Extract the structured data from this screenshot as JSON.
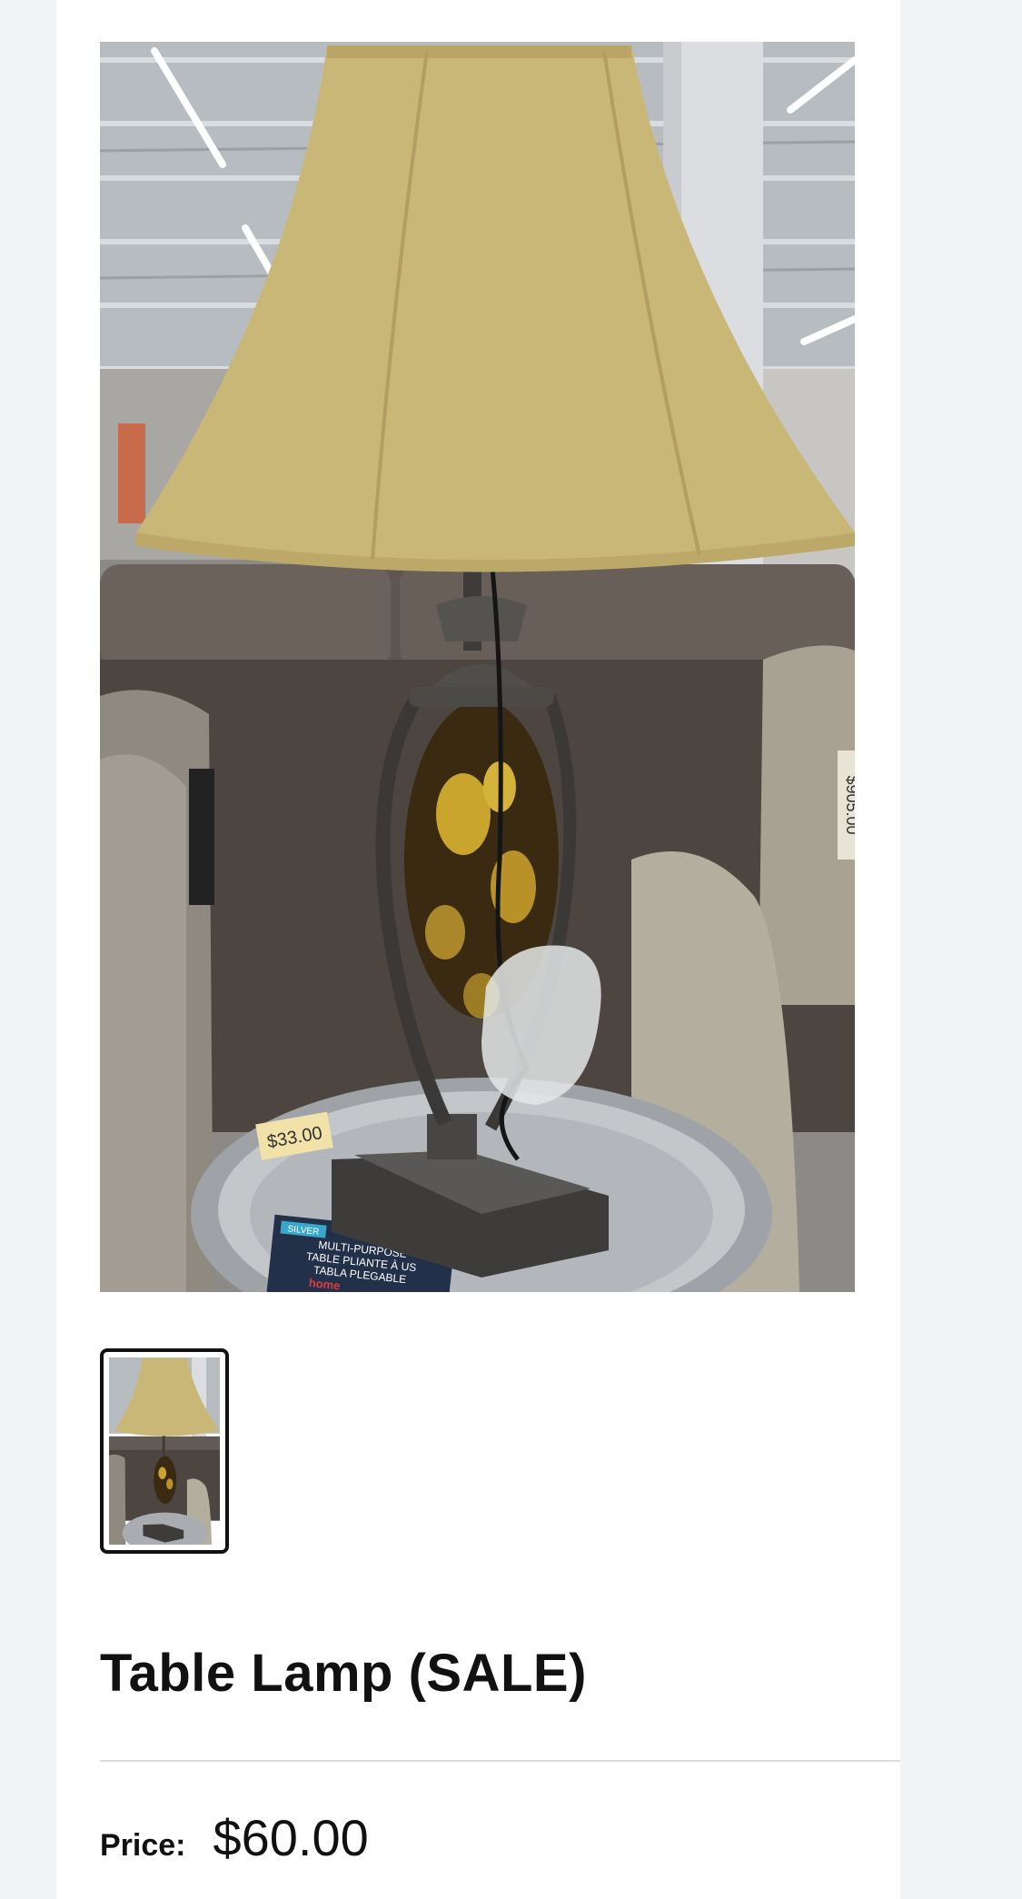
{
  "product": {
    "title": "Table Lamp (SALE)",
    "price_label": "Price:",
    "price_value": "$60.00"
  },
  "gallery": {
    "main_image": "table-lamp-photo",
    "thumbnails": [
      "table-lamp-thumbnail"
    ],
    "selected_index": 0
  },
  "photo_text": {
    "price_tag": "$33.00",
    "right_tag": "$905.00",
    "box_badge": "SILVER",
    "box_line1": "MULTI-PURPOSE",
    "box_line2": "TABLE PLIANTE À US",
    "box_line3": "TABLA PLEGABLE",
    "box_brand": "home"
  },
  "colors": {
    "page_bg": "#f2f3f5",
    "card_bg": "#ffffff",
    "text": "#111111",
    "divider": "#dcdcdc",
    "thumb_border": "#111111"
  }
}
